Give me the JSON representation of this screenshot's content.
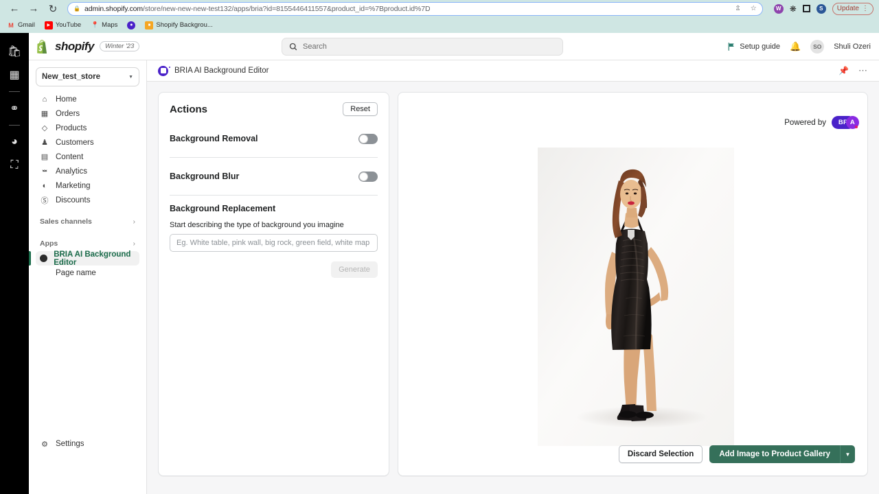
{
  "browser": {
    "back_icon": "back-arrow",
    "forward_icon": "forward-arrow",
    "reload_icon": "reload",
    "lock_icon": "lock",
    "url_host": "admin.shopify.com",
    "url_path": "/store/new-new-new-test132/apps/bria?id=8155446411557&product_id=%7Bproduct.id%7D",
    "share_icon": "share",
    "star_icon": "bookmark-star",
    "update_label": "Update",
    "menu_icon": "kebab-menu",
    "extension_w": "W",
    "extension_s": "S",
    "bookmarks": [
      {
        "label": "Gmail",
        "icon": "M"
      },
      {
        "label": "YouTube",
        "icon": "▶"
      },
      {
        "label": "Maps",
        "icon": "📍"
      },
      {
        "label": "",
        "icon": "bria"
      },
      {
        "label": "Shopify Backgrou...",
        "icon": "■"
      }
    ]
  },
  "rail": {
    "items": [
      "shopify-bag-icon",
      "grid-icon",
      "separator",
      "nodes-icon",
      "separator",
      "pie-gear-icon",
      "store-gear-icon"
    ]
  },
  "topbar": {
    "brand": "shopify",
    "release_pill": "Winter '23",
    "search_placeholder": "Search",
    "search_icon": "search-icon",
    "setup_guide": "Setup guide",
    "flag_icon": "flag-icon",
    "bell_icon": "bell-icon",
    "avatar_initials": "SO",
    "user_name": "Shuli Ozeri"
  },
  "sidebar": {
    "store_name": "New_test_store",
    "items": [
      {
        "label": "Home",
        "icon": "⌂"
      },
      {
        "label": "Orders",
        "icon": "▢"
      },
      {
        "label": "Products",
        "icon": "⬥"
      },
      {
        "label": "Customers",
        "icon": "●"
      },
      {
        "label": "Content",
        "icon": "▤"
      },
      {
        "label": "Analytics",
        "icon": "▐"
      },
      {
        "label": "Marketing",
        "icon": "◔"
      },
      {
        "label": "Discounts",
        "icon": "⊘"
      }
    ],
    "sales_channels": "Sales channels",
    "apps": "Apps",
    "active_app": "BRIA AI Background Editor",
    "page_name": "Page name",
    "settings": "Settings"
  },
  "app_header": {
    "title": "BRIA AI Background Editor",
    "pin_icon": "pin-icon",
    "more_icon": "more-icon"
  },
  "actions": {
    "title": "Actions",
    "reset_label": "Reset",
    "background_removal_label": "Background Removal",
    "background_removal_on": false,
    "background_blur_label": "Background Blur",
    "background_blur_on": false,
    "background_replacement_label": "Background Replacement",
    "prompt_help": "Start describing the type of background you imagine",
    "prompt_value": "",
    "prompt_placeholder": "Eg. White table, pink wall, big rock, green field, white map",
    "generate_label": "Generate"
  },
  "preview": {
    "powered_by": "Powered by",
    "logo_main": "BR",
    "logo_accent": "A",
    "discard_label": "Discard Selection",
    "add_label": "Add Image to Product Gallery",
    "caret_icon": "chevron-down-icon",
    "image_alt": "Woman in black satin dress on white studio background"
  },
  "colors": {
    "brand_green": "#35705a",
    "bria_purple": "#4a22c9",
    "bria_magenta": "#8a2be2",
    "accent_pink": "#e5186a",
    "chrome_bg": "#cfe6e3",
    "canvas_bg": "#f6f6f7"
  }
}
